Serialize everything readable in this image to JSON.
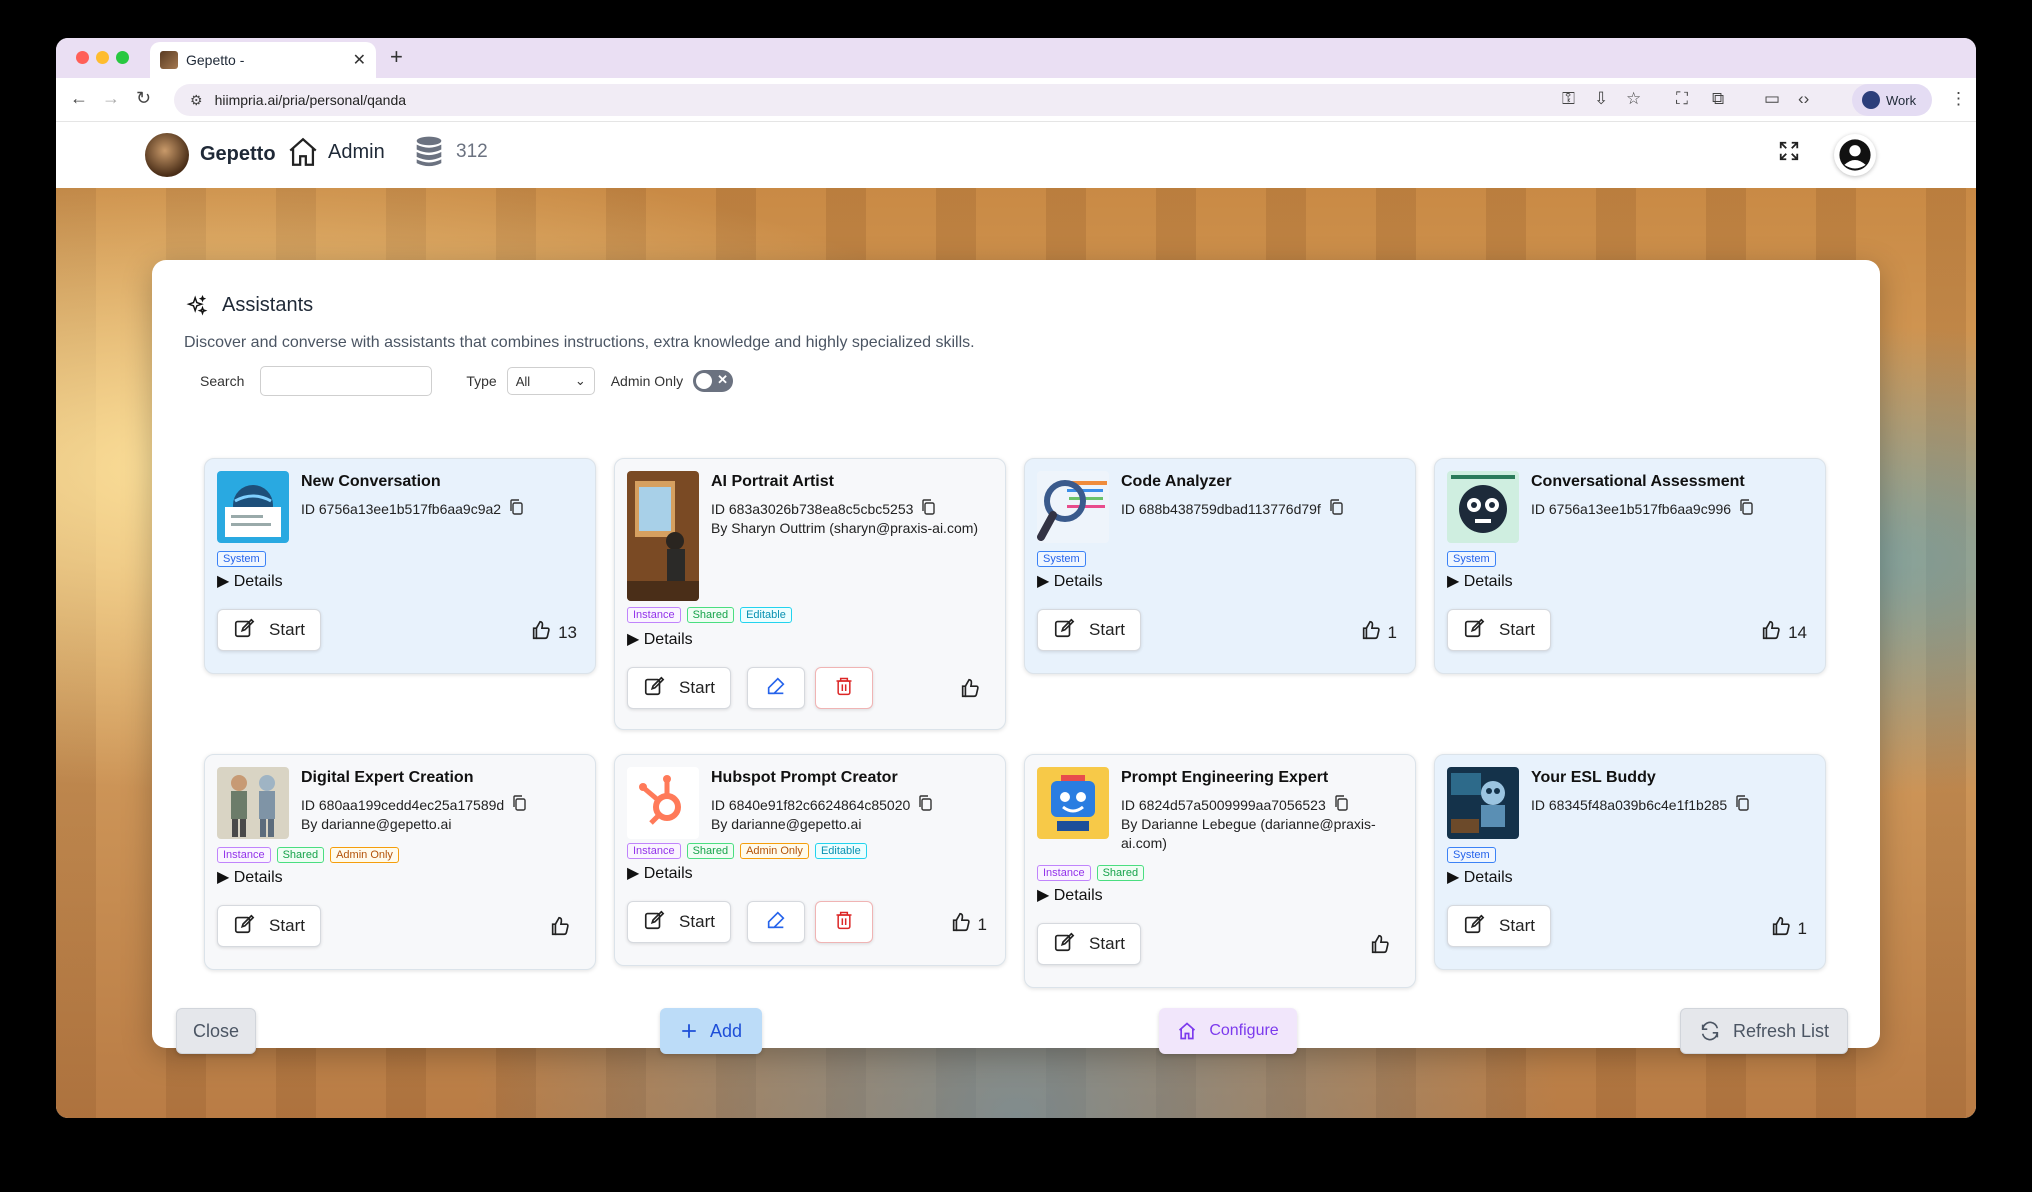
{
  "browser": {
    "tab_title": "Gepetto -",
    "url": "hiimpria.ai/pria/personal/qanda",
    "profile_label": "Work"
  },
  "app": {
    "brand": "Gepetto",
    "admin_label": "Admin",
    "credits": "312"
  },
  "modal": {
    "title": "Assistants",
    "description": "Discover and converse with assistants that combines instructions, extra knowledge and highly specialized skills.",
    "search_label": "Search",
    "search_value": "",
    "type_label": "Type",
    "type_value": "All",
    "admin_only_label": "Admin Only",
    "admin_only_on": false,
    "details_label": "Details",
    "start_label": "Start",
    "close_label": "Close",
    "add_label": "Add",
    "configure_label": "Configure",
    "refresh_label": "Refresh List"
  },
  "assistants": [
    {
      "name": "New Conversation",
      "id": "ID 6756a13ee1b517fb6aa9c9a2",
      "by": "",
      "badges": [
        "System"
      ],
      "likes": "13",
      "editable": false,
      "thumb": "globe-screen"
    },
    {
      "name": "AI Portrait Artist",
      "id": "ID 683a3026b738ea8c5cbc5253",
      "by": "By Sharyn Outtrim (sharyn@praxis-ai.com)",
      "badges": [
        "Instance",
        "Shared",
        "Editable"
      ],
      "likes": "",
      "editable": true,
      "thumb": "painter"
    },
    {
      "name": "Code Analyzer",
      "id": "ID 688b438759dbad113776d79f",
      "by": "",
      "badges": [
        "System"
      ],
      "likes": "1",
      "editable": false,
      "thumb": "magnifier"
    },
    {
      "name": "Conversational Assessment",
      "id": "ID 6756a13ee1b517fb6aa9c996",
      "by": "",
      "badges": [
        "System"
      ],
      "likes": "14",
      "editable": false,
      "thumb": "robot-face"
    },
    {
      "name": "Digital Expert Creation",
      "id": "ID 680aa199cedd4ec25a17589d",
      "by": "By darianne@gepetto.ai",
      "badges": [
        "Instance",
        "Shared",
        "Admin Only"
      ],
      "likes": "",
      "editable": false,
      "thumb": "human-robot"
    },
    {
      "name": "Hubspot Prompt Creator",
      "id": "ID 6840e91f82c6624864c85020",
      "by": "By darianne@gepetto.ai",
      "badges": [
        "Instance",
        "Shared",
        "Admin Only",
        "Editable"
      ],
      "likes": "1",
      "editable": true,
      "thumb": "hubspot-logo"
    },
    {
      "name": "Prompt Engineering Expert",
      "id": "ID 6824d57a5009999aa7056523",
      "by": "By Darianne Lebegue (darianne@praxis-ai.com)",
      "badges": [
        "Instance",
        "Shared"
      ],
      "likes": "",
      "editable": false,
      "thumb": "cartoon-computer"
    },
    {
      "name": "Your ESL Buddy",
      "id": "ID 68345f48a039b6c4e1f1b285",
      "by": "",
      "badges": [
        "System"
      ],
      "likes": "1",
      "editable": false,
      "thumb": "robot-teacher"
    }
  ],
  "colors": {
    "system_card_bg": "#e8f2fc",
    "plain_card_bg": "#f7f8fa",
    "add_button_bg": "#bcdcf8",
    "configure_button_bg": "#f1e6fb",
    "delete_red": "#dc2626",
    "edit_blue": "#2563eb"
  }
}
